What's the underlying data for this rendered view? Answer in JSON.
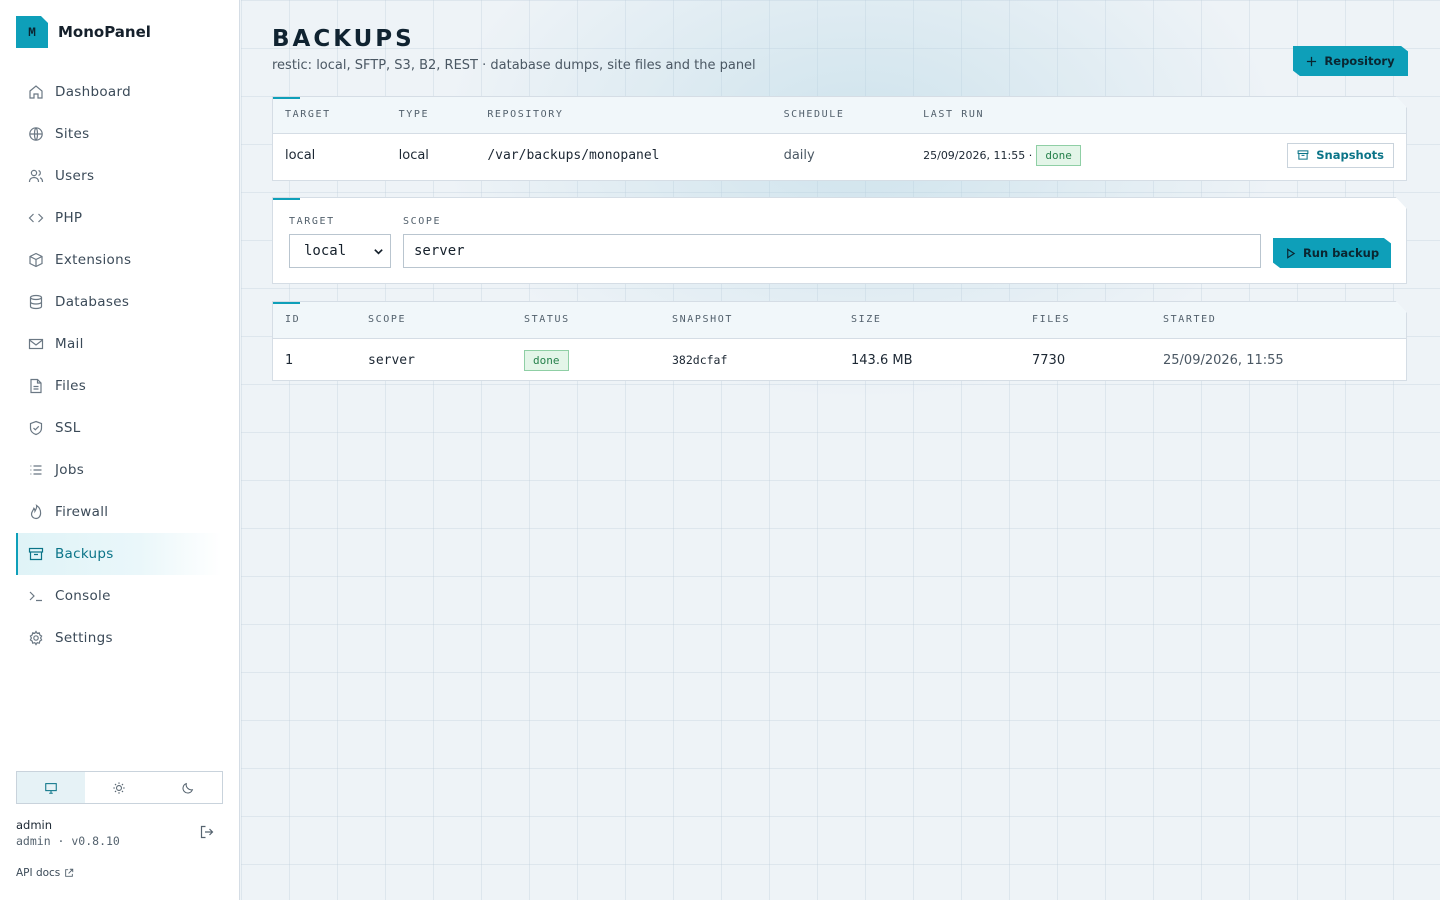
{
  "app": {
    "logo_letter": "M",
    "name": "MonoPanel",
    "accent": "#0e9fb9"
  },
  "sidebar": {
    "items": [
      {
        "label": "Dashboard",
        "icon": "home-icon"
      },
      {
        "label": "Sites",
        "icon": "globe-icon"
      },
      {
        "label": "Users",
        "icon": "users-icon"
      },
      {
        "label": "PHP",
        "icon": "code-icon"
      },
      {
        "label": "Extensions",
        "icon": "package-icon"
      },
      {
        "label": "Databases",
        "icon": "database-icon"
      },
      {
        "label": "Mail",
        "icon": "mail-icon"
      },
      {
        "label": "Files",
        "icon": "file-icon"
      },
      {
        "label": "SSL",
        "icon": "shield-icon"
      },
      {
        "label": "Jobs",
        "icon": "list-icon"
      },
      {
        "label": "Firewall",
        "icon": "flame-icon"
      },
      {
        "label": "Backups",
        "icon": "archive-icon",
        "active": true
      },
      {
        "label": "Console",
        "icon": "terminal-icon"
      },
      {
        "label": "Settings",
        "icon": "gear-icon"
      }
    ],
    "theme_options": [
      "monitor-icon",
      "sun-icon",
      "moon-icon"
    ],
    "theme_selected": "monitor-icon",
    "user": {
      "name": "admin",
      "meta": "admin · v0.8.10"
    },
    "api_docs_label": "API docs"
  },
  "page": {
    "title": "BACKUPS",
    "subtitle": "restic: local, SFTP, S3, B2, REST · database dumps, site files and the panel",
    "add_repository_label": "Repository"
  },
  "targets_table": {
    "columns": [
      "TARGET",
      "TYPE",
      "REPOSITORY",
      "SCHEDULE",
      "LAST RUN"
    ],
    "rows": [
      {
        "target": "local",
        "type": "local",
        "repository": "/var/backups/monopanel",
        "schedule": "daily",
        "last_run": "25/09/2026, 11:55 ·",
        "last_status": "done",
        "action_label": "Snapshots"
      }
    ]
  },
  "run_form": {
    "target_label": "TARGET",
    "target_value": "local",
    "scope_label": "SCOPE",
    "scope_value": "server",
    "run_label": "Run backup"
  },
  "runs_table": {
    "columns": [
      "ID",
      "SCOPE",
      "STATUS",
      "SNAPSHOT",
      "SIZE",
      "FILES",
      "STARTED"
    ],
    "rows": [
      {
        "id": "1",
        "scope": "server",
        "status": "done",
        "snapshot": "382dcfaf",
        "size": "143.6 MB",
        "files": "7730",
        "started": "25/09/2026, 11:55"
      }
    ]
  },
  "colors": {
    "success": "#27814c",
    "success_bg": "#e3f5e8"
  }
}
